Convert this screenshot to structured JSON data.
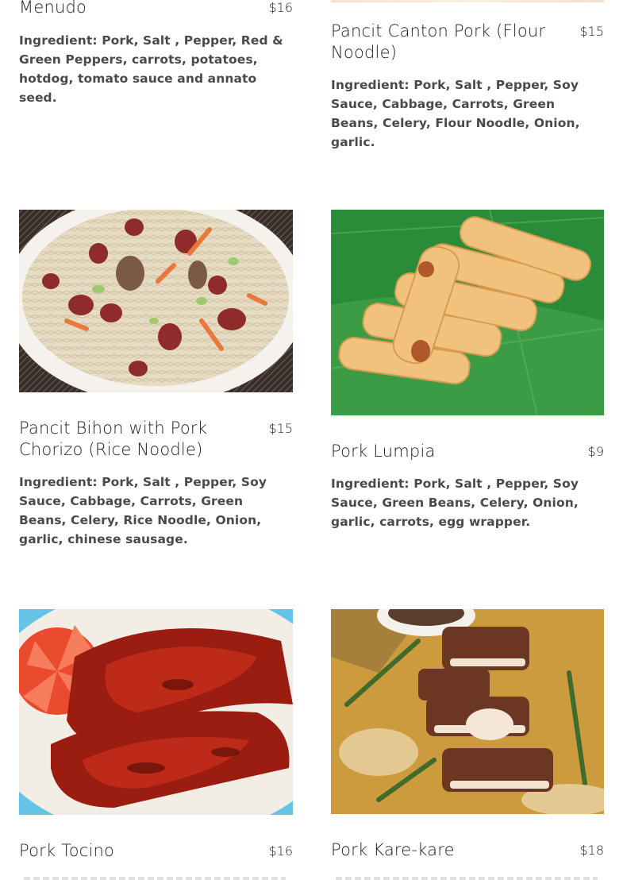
{
  "menu": {
    "items": [
      {
        "name": "Menudo",
        "price": "$16",
        "description": "Ingredient: Pork, Salt , Pepper,  Red & Green Peppers, carrots, potatoes, hotdog, tomato sauce and annato seed."
      },
      {
        "name": "Pancit Canton Pork (Flour Noodle)",
        "price": "$15",
        "description": "Ingredient: Pork, Salt , Pepper, Soy Sauce, Cabbage, Carrots, Green Beans, Celery, Flour Noodle, Onion, garlic."
      },
      {
        "name": "Pancit Bihon with Pork Chorizo (Rice Noodle)",
        "price": "$15",
        "description": "Ingredient: Pork, Salt , Pepper, Soy Sauce, Cabbage, Carrots, Green Beans, Celery, Rice Noodle, Onion, garlic, chinese sausage."
      },
      {
        "name": "Pork Lumpia",
        "price": "$9",
        "description": "Ingredient: Pork, Salt , Pepper, Soy Sauce, Green Beans, Celery, Onion, garlic, carrots, egg wrapper."
      },
      {
        "name": "Pork Tocino",
        "price": "$16"
      },
      {
        "name": "Pork Kare-kare",
        "price": "$18"
      }
    ]
  },
  "colors": {
    "text": "#1f1f1f",
    "description": "#4a4a4a",
    "background": "#ffffff"
  }
}
